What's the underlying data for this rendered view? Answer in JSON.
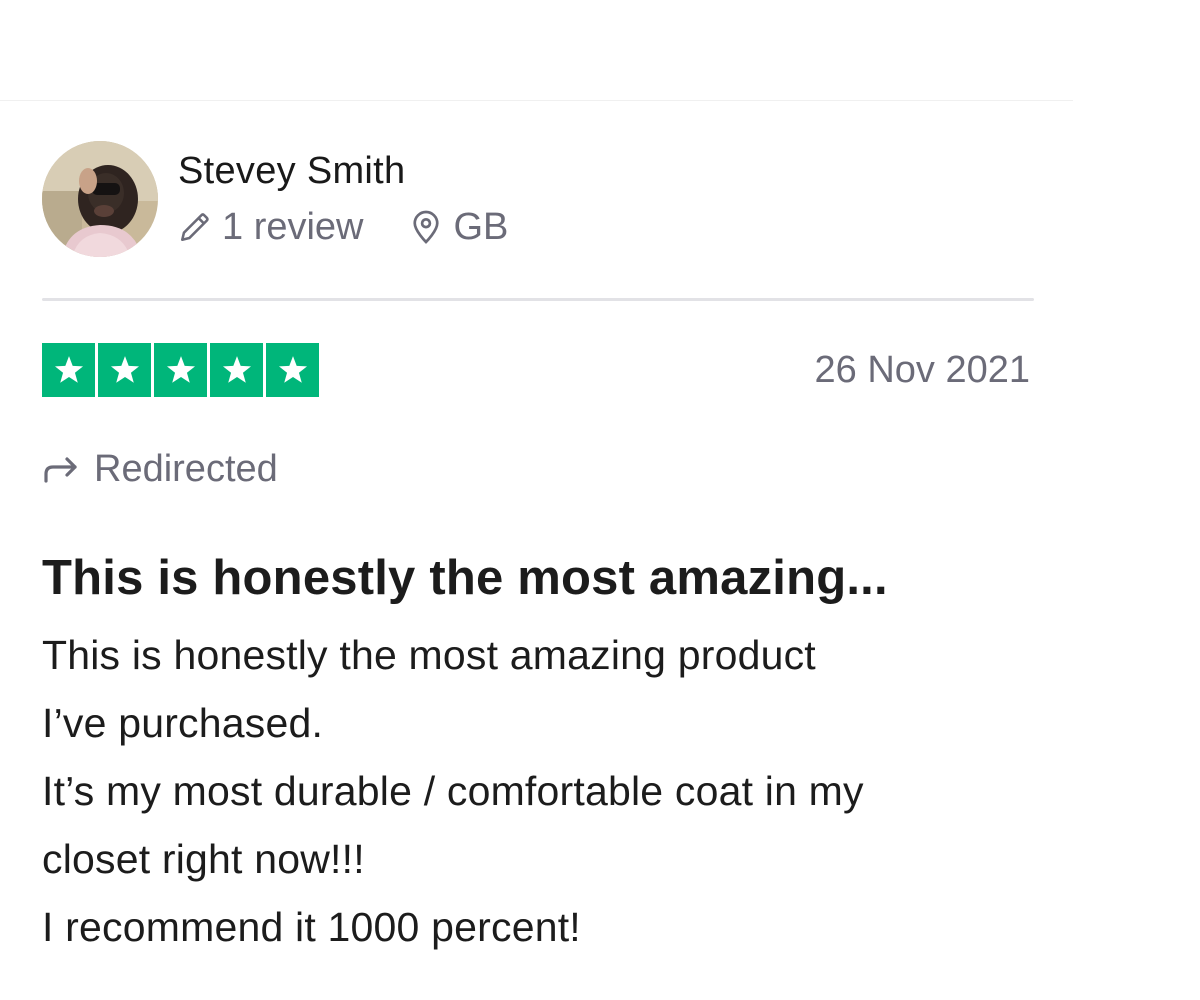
{
  "consumer": {
    "name": "Stevey Smith",
    "reviews_count": "1 review",
    "location": "GB",
    "avatar_icon": "user-photo-avatar"
  },
  "review": {
    "rating": 5,
    "max_rating": 5,
    "star_color": "#00b67a",
    "date": "26 Nov 2021",
    "source": "Redirected",
    "title": "This is honestly the most amazing...",
    "body_lines": [
      "This is honestly the most amazing product",
      "I’ve purchased.",
      "It’s my most durable / comfortable coat in my",
      "closet right now!!!",
      "I recommend it 1000 percent!"
    ]
  },
  "colors": {
    "muted_text": "#6b6b78",
    "divider": "#e2e2e6"
  }
}
